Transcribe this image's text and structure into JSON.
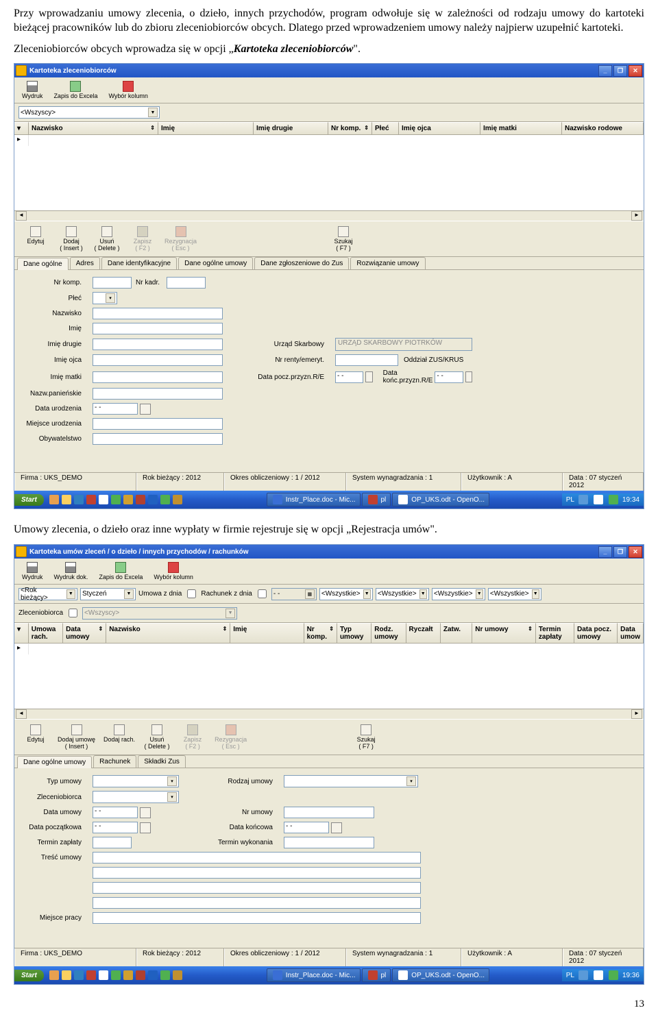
{
  "paragraphs": {
    "p1": "Przy wprowadzaniu umowy zlecenia, o dzieło, innych przychodów, program odwołuje się w zależności od rodzaju umowy do kartoteki bieżącej pracowników lub do zbioru zleceniobiorców obcych. Dlatego przed wprowadzeniem umowy  należy najpierw uzupełnić kartoteki.",
    "p2a": "Zleceniobiorców obcych wprowadza się w opcji „",
    "p2b": "Kartoteka zleceniobiorców",
    "p2c": "\".",
    "p3a": "Umowy zlecenia, o dzieło oraz inne wypłaty w firmie rejestruje się w opcji „",
    "p3b": "Rejestracja umów",
    "p3c": "\"."
  },
  "shot1": {
    "title": "Kartoteka zleceniobiorców",
    "toolbar": {
      "print": "Wydruk",
      "excel": "Zapis do Excela",
      "cols": "Wybór kolumn"
    },
    "filter": "<Wszyscy>",
    "cols": {
      "nazwisko": "Nazwisko",
      "imie": "Imię",
      "imie2": "Imię drugie",
      "nrkomp": "Nr komp.",
      "plec": "Płeć",
      "imieojca": "Imię ojca",
      "imiematki": "Imię matki",
      "nazwrodowe": "Nazwisko rodowe"
    },
    "actions": {
      "edit": "Edytuj",
      "add": "Dodaj",
      "addkey": "( Insert )",
      "del": "Usuń",
      "delkey": "( Delete )",
      "save": "Zapisz",
      "savekey": "( F2 )",
      "cancel": "Rezygnacja",
      "cancelkey": "( Esc )",
      "search": "Szukaj",
      "searchkey": "( F7 )"
    },
    "tabs": {
      "t1": "Dane ogólne",
      "t2": "Adres",
      "t3": "Dane identyfikacyjne",
      "t4": "Dane ogólne umowy",
      "t5": "Dane zgłoszeniowe do Zus",
      "t6": "Rozwiązanie umowy"
    },
    "form": {
      "nrkomp": "Nr komp.",
      "nrkadr": "Nr kadr.",
      "plec": "Płeć",
      "nazwisko": "Nazwisko",
      "imie": "Imię",
      "imie2": "Imię drugie",
      "imieojca": "Imię ojca",
      "imiematki": "Imię matki",
      "nazwpan": "Nazw.panieńskie",
      "dataur": "Data urodzenia",
      "miejsceur": "Miejsce urodzenia",
      "obyw": "Obywatelstwo",
      "urzad": "Urząd Skarbowy",
      "urzadval": "URZĄD SKARBOWY PIOTRKÓW",
      "nrrenty": "Nr renty/emeryt.",
      "oddzial": "Oddział ZUS/KRUS",
      "datapocz": "Data pocz.przyzn.R/E",
      "datakon": "Data końc.przyzn.R/E",
      "dateblank": "-  -"
    },
    "status": {
      "firma": "Firma : UKS_DEMO",
      "rok": "Rok bieżący : 2012",
      "okres": "Okres obliczeniowy : 1 / 2012",
      "system": "System wynagradzania : 1",
      "user": "Użytkownik : A",
      "data": "Data : 07 styczeń 2012"
    },
    "taskbar": {
      "start": "Start",
      "doc1": "Instr_Place.doc - Mic...",
      "doc2": "pl",
      "doc3": "OP_UKS.odt - OpenO...",
      "lang": "PL",
      "time": "19:34"
    }
  },
  "shot2": {
    "title": "Kartoteka umów zleceń / o dzieło / innych przychodów / rachunków",
    "toolbar": {
      "print": "Wydruk",
      "printdoc": "Wydruk dok.",
      "excel": "Zapis do Excela",
      "cols": "Wybór kolumn"
    },
    "filters": {
      "rok": "<Rok bieżący>",
      "mies": "Styczeń",
      "umowa": "Umowa z dnia",
      "rach": "Rachunek z dnia",
      "w": "<Wszystkie>",
      "zlec": "Zleceniobiorca",
      "wszyscy": "<Wszyscy>",
      "dateblank": "-  -"
    },
    "cols": {
      "umowarach": "Umowa rach.",
      "dataumowy": "Data umowy",
      "nazwisko": "Nazwisko",
      "imie": "Imię",
      "nrkomp": "Nr komp.",
      "typumowy": "Typ umowy",
      "rodzumowy": "Rodz. umowy",
      "ryczalt": "Ryczałt",
      "zatw": "Zatw.",
      "nrumowy": "Nr umowy",
      "terminzap": "Termin zapłaty",
      "datapocz": "Data pocz. umowy",
      "dataumow": "Data umow"
    },
    "actions": {
      "edit": "Edytuj",
      "add": "Dodaj umowę",
      "addkey": "( Insert )",
      "addr": "Dodaj rach.",
      "del": "Usuń",
      "delkey": "( Delete )",
      "save": "Zapisz",
      "savekey": "( F2 )",
      "cancel": "Rezygnacja",
      "cancelkey": "( Esc )",
      "search": "Szukaj",
      "searchkey": "( F7 )"
    },
    "tabs": {
      "t1": "Dane ogólne umowy",
      "t2": "Rachunek",
      "t3": "Składki Zus"
    },
    "form": {
      "typ": "Typ umowy",
      "rodz": "Rodzaj umowy",
      "zlec": "Zleceniobiorca",
      "datau": "Data umowy",
      "nru": "Nr umowy",
      "datap": "Data początkowa",
      "datak": "Data końcowa",
      "terminz": "Termin zapłaty",
      "terminw": "Termin wykonania",
      "tresc": "Treść umowy",
      "miejsce": "Miejsce pracy",
      "dateblank": "-  -"
    },
    "status": {
      "firma": "Firma : UKS_DEMO",
      "rok": "Rok bieżący : 2012",
      "okres": "Okres obliczeniowy : 1 / 2012",
      "system": "System wynagradzania : 1",
      "user": "Użytkownik : A",
      "data": "Data : 07 styczeń 2012"
    },
    "taskbar": {
      "start": "Start",
      "doc1": "Instr_Place.doc - Mic...",
      "doc2": "pl",
      "doc3": "OP_UKS.odt - OpenO...",
      "lang": "PL",
      "time": "19:36"
    }
  },
  "pagenum": "13"
}
